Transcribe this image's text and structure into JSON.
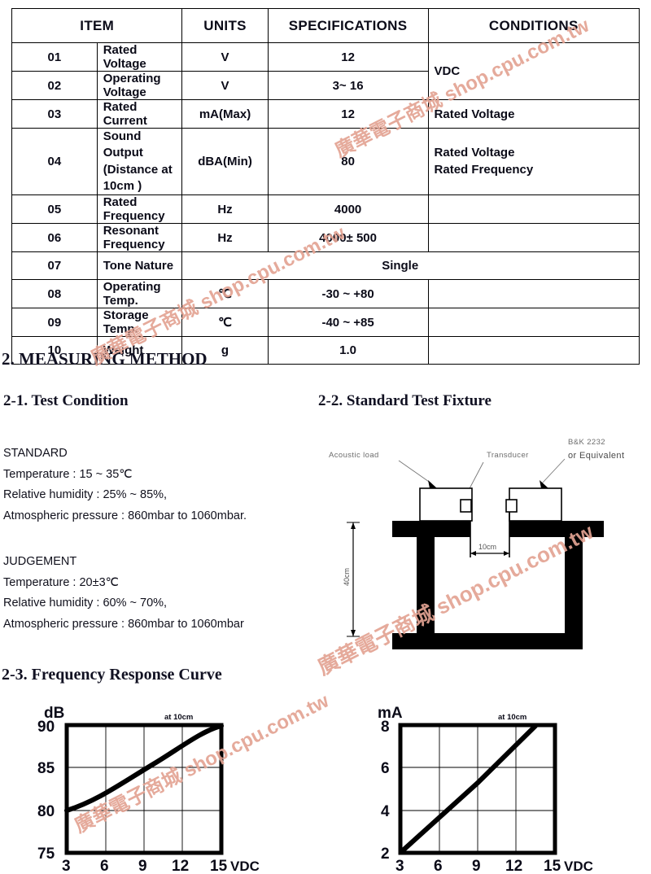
{
  "watermark": {
    "text": "廣華電子商城 shop.cpu.com.tw",
    "color": "#e3a393"
  },
  "spec_table": {
    "headers": [
      "",
      "ITEM",
      "UNITS",
      "SPECIFICATIONS",
      "CONDITIONS"
    ],
    "rows": [
      {
        "no": "01",
        "item": "Rated Voltage",
        "units": "V",
        "spec": "12",
        "cond": "VDC"
      },
      {
        "no": "02",
        "item": "Operating Voltage",
        "units": "V",
        "spec": "3~ 16",
        "cond": ""
      },
      {
        "no": "03",
        "item": "Rated Current",
        "units": "mA(Max)",
        "spec": "12",
        "cond": "Rated Voltage"
      },
      {
        "no": "04",
        "item_line1": "Sound Output",
        "item_line2": "(Distance at 10cm )",
        "units": "dBA(Min)",
        "spec": "80",
        "cond_line1": "Rated Voltage",
        "cond_line2": "Rated Frequency"
      },
      {
        "no": "05",
        "item": "Rated Frequency",
        "units": "Hz",
        "spec": "4000",
        "cond": ""
      },
      {
        "no": "06",
        "item": "Resonant Frequency",
        "units": "Hz",
        "spec": "4000± 500",
        "cond": ""
      },
      {
        "no": "07",
        "item": "Tone Nature",
        "units": "",
        "spec": "Single",
        "cond": ""
      },
      {
        "no": "08",
        "item": "Operating Temp.",
        "units": "℃",
        "spec": "-30 ~ +80",
        "cond": ""
      },
      {
        "no": "09",
        "item": "Storage Temp.",
        "units": "℃",
        "spec": "-40 ~ +85",
        "cond": ""
      },
      {
        "no": "10",
        "item": "Weight",
        "units": "g",
        "spec": "1.0",
        "cond": ""
      }
    ]
  },
  "headings": {
    "measuring_method": "2. MEASURING METHOD",
    "test_condition": "2-1. Test Condition",
    "standard_test_fixture": "2-2. Standard Test Fixture",
    "frequency_response_curve": "2-3. Frequency Response Curve"
  },
  "test_condition": {
    "standard": {
      "title": "STANDARD",
      "temperature": "Temperature : 15 ~ 35℃",
      "humidity": "Relative humidity : 25% ~ 85%,",
      "pressure": "Atmospheric pressure : 860mbar to 1060mbar."
    },
    "judgement": {
      "title": "JUDGEMENT",
      "temperature": "Temperature : 20±3℃",
      "humidity": "Relative humidity : 60% ~ 70%,",
      "pressure": "Atmospheric pressure : 860mbar to 1060mbar"
    }
  },
  "fixture": {
    "label_acoustic_load": "Acoustic load",
    "label_transducer": "Transducer",
    "label_bk_line1": "B&K  2232",
    "label_bk_line2": "or Equivalent",
    "dim_horizontal": "10cm",
    "dim_vertical": "40cm"
  },
  "chart_data": [
    {
      "id": "db_curve",
      "type": "line",
      "title": "",
      "xlabel": "VDC",
      "ylabel": "dB",
      "annotation": "at 10cm",
      "xlim": [
        3,
        15
      ],
      "ylim": [
        75,
        90
      ],
      "xticks": [
        3,
        6,
        9,
        12,
        15
      ],
      "yticks": [
        75,
        80,
        85,
        90
      ],
      "grid": true,
      "x": [
        3,
        4.5,
        6,
        7.5,
        9,
        10.5,
        12,
        13.5,
        15
      ],
      "y": [
        80.0,
        81.5,
        83.0,
        84.6,
        86.2,
        87.6,
        88.7,
        89.5,
        90.0
      ]
    },
    {
      "id": "ma_curve",
      "type": "line",
      "title": "",
      "xlabel": "VDC",
      "ylabel": "mA",
      "annotation": "at 10cm",
      "xlim": [
        3,
        15
      ],
      "ylim": [
        2,
        8
      ],
      "xticks": [
        3,
        6,
        9,
        12,
        15
      ],
      "yticks": [
        2,
        4,
        6,
        8
      ],
      "grid": true,
      "x": [
        3,
        6,
        9,
        12,
        13.5
      ],
      "y": [
        2.0,
        3.9,
        5.3,
        7.1,
        8.0
      ]
    }
  ]
}
